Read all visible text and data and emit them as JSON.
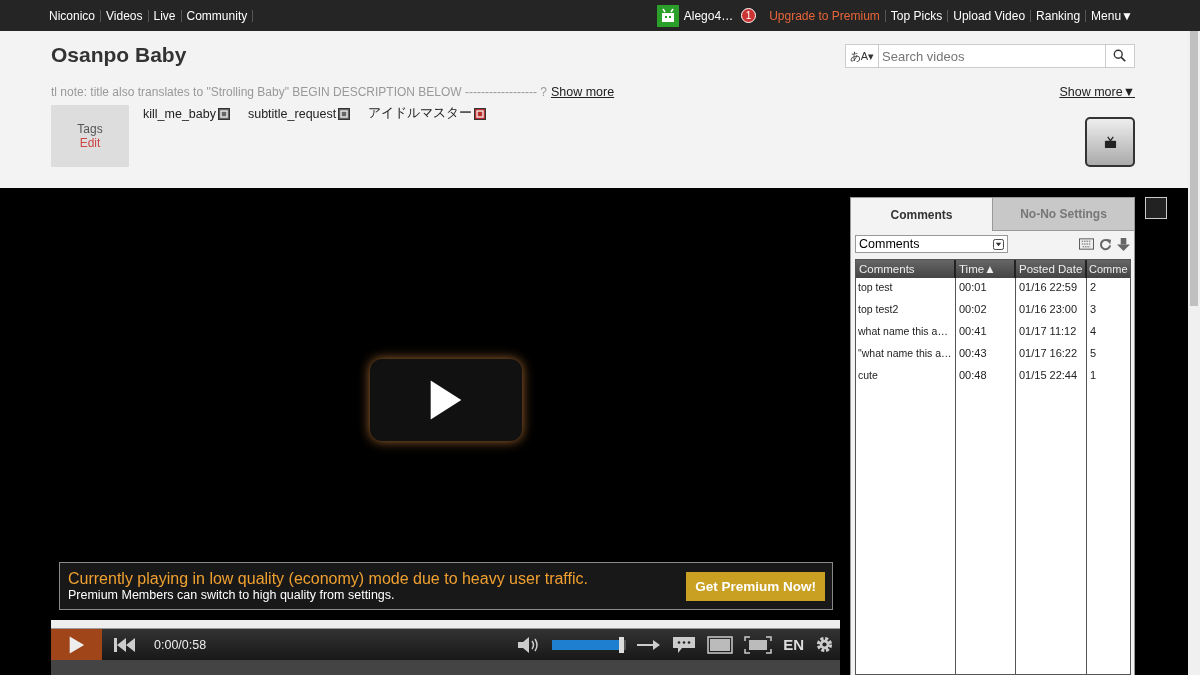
{
  "top_nav": {
    "left_links": [
      "Niconico",
      "Videos",
      "Live",
      "Community"
    ],
    "user_name": "Alego4…",
    "notification_count": "1",
    "right_links": [
      {
        "label": "Upgrade to Premium",
        "kind": "premium"
      },
      {
        "label": "Top Picks",
        "kind": "link"
      },
      {
        "label": "Upload Video",
        "kind": "link"
      },
      {
        "label": "Ranking",
        "kind": "link"
      },
      {
        "label": "Menu▼",
        "kind": "link"
      }
    ]
  },
  "header": {
    "title": "Osanpo Baby",
    "search": {
      "language_toggle": "あA▾",
      "placeholder": "Search videos"
    },
    "description": "tl note: title also translates to \"Strolling Baby\" BEGIN DESCRIPTION BELOW ------------------ ?",
    "show_more_description": "Show more",
    "show_more_right": "Show more▼",
    "tags_label": "Tags",
    "tags_edit": "Edit",
    "tags": [
      {
        "label": "kill_me_baby",
        "locked": false
      },
      {
        "label": "subtitle_request",
        "locked": false
      },
      {
        "label": "アイドルマスター",
        "locked": true
      }
    ]
  },
  "player": {
    "notice_title": "Currently playing in low quality (economy) mode due to heavy user traffic.",
    "notice_text": "Premium Members can switch to high quality from settings.",
    "notice_button": "Get Premium Now!",
    "time": "0:00/0:58",
    "volume": {
      "level": 0.95
    },
    "language": "EN"
  },
  "comments_panel": {
    "tabs": [
      {
        "label": "Comments",
        "selected": true
      },
      {
        "label": "No-No Settings",
        "selected": false
      }
    ],
    "dropdown": "Comments",
    "table": {
      "columns": [
        "Comments",
        "Time▲",
        "Posted Date",
        "Comme"
      ],
      "rows": [
        [
          "top test",
          "00:01",
          "01/16 22:59",
          "2"
        ],
        [
          "top test2",
          "00:02",
          "01/16 23:00",
          "3"
        ],
        [
          "what name this a…",
          "00:41",
          "01/17 11:12",
          "4"
        ],
        [
          "\"what name this a…",
          "00:43",
          "01/17 16:22",
          "5"
        ],
        [
          "cute",
          "00:48",
          "01/15 22:44",
          "1"
        ]
      ]
    }
  }
}
